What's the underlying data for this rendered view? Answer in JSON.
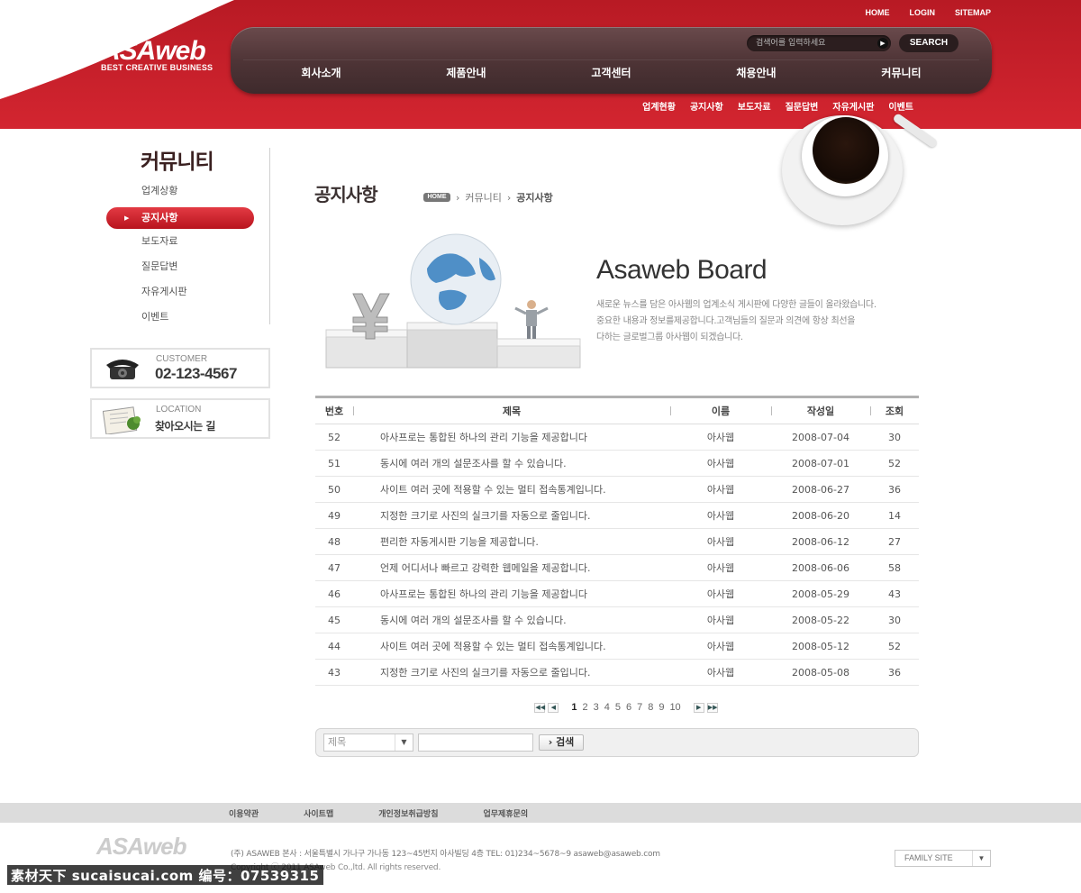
{
  "header": {
    "brand": {
      "name": "ASAweb",
      "tagline": "BEST CREATIVE BUSINESS"
    },
    "top_links": [
      "HOME",
      "LOGIN",
      "SITEMAP"
    ],
    "search": {
      "placeholder": "검색어를 입력하세요",
      "button_label": "SEARCH"
    },
    "main_nav": [
      "회사소개",
      "제품안내",
      "고객센터",
      "채용안내",
      "커뮤니티"
    ],
    "sub_nav": [
      "업계현황",
      "공지사항",
      "보도자료",
      "질문답변",
      "자유게시판",
      "이벤트"
    ]
  },
  "sidebar": {
    "title": "커뮤니티",
    "items": [
      {
        "label": "업계상황",
        "active": false
      },
      {
        "label": "공지사항",
        "active": true
      },
      {
        "label": "보도자료",
        "active": false
      },
      {
        "label": "질문답변",
        "active": false
      },
      {
        "label": "자유게시판",
        "active": false
      },
      {
        "label": "이벤트",
        "active": false
      }
    ],
    "customer": {
      "label": "CUSTOMER",
      "value": "02-123-4567"
    },
    "location": {
      "label": "LOCATION",
      "value": "찾아오시는 길"
    }
  },
  "content": {
    "page_title": "공지사항",
    "breadcrumb": {
      "home": "HOME",
      "section": "커뮤니티",
      "current": "공지사항"
    },
    "board_title": "Asaweb Board",
    "board_desc": [
      "새로운 뉴스를 담은 아사웹의 업계소식 게시판에 다양한 글들이 올라왔습니다.",
      "중요한 내용과 정보를제공합니다.고객님들의 질문과 의견에 항상 최선을",
      "다하는 글로벌그룹 아사웹이 되겠습니다."
    ],
    "table": {
      "columns": [
        "번호",
        "제목",
        "이름",
        "작성일",
        "조회"
      ],
      "rows": [
        [
          "52",
          "아사프로는 통합된 하나의 관리 기능을 제공합니다",
          "아사웹",
          "2008-07-04",
          "30"
        ],
        [
          "51",
          "동시에 여러 개의 설문조사를 할 수 있습니다.",
          "아사웹",
          "2008-07-01",
          "52"
        ],
        [
          "50",
          "사이트 여러 곳에 적용할 수 있는 멀티 접속통계입니다.",
          "아사웹",
          "2008-06-27",
          "36"
        ],
        [
          "49",
          "지정한 크기로 사진의 실크기를 자동으로 줄입니다.",
          "아사웹",
          "2008-06-20",
          "14"
        ],
        [
          "48",
          "편리한 자동게시판 기능을 제공합니다.",
          "아사웹",
          "2008-06-12",
          "27"
        ],
        [
          "47",
          "언제 어디서나 빠르고 강력한 웹메일을 제공합니다.",
          "아사웹",
          "2008-06-06",
          "58"
        ],
        [
          "46",
          "아사프로는 통합된 하나의 관리 기능을 제공합니다",
          "아사웹",
          "2008-05-29",
          "43"
        ],
        [
          "45",
          "동시에 여러 개의 설문조사를 할 수 있습니다.",
          "아사웹",
          "2008-05-22",
          "30"
        ],
        [
          "44",
          "사이트 여러 곳에 적용할 수 있는 멀티 접속통계입니다.",
          "아사웹",
          "2008-05-12",
          "52"
        ],
        [
          "43",
          "지정한 크기로 사진의 실크기를 자동으로 줄입니다.",
          "아사웹",
          "2008-05-08",
          "36"
        ]
      ]
    },
    "pagination": {
      "pages": [
        "1",
        "2",
        "3",
        "4",
        "5",
        "6",
        "7",
        "8",
        "9",
        "10"
      ],
      "current": "1"
    },
    "search": {
      "select_value": "제목",
      "button_label": "검색"
    }
  },
  "footer": {
    "links": [
      "이용약관",
      "사이트맵",
      "개인정보취급방침",
      "업무제휴문의"
    ],
    "logo": "ASAweb",
    "address": "(주) ASAWEB   본사 : 서울특별시 가나구 가나동 123~45번지  아사빌딩 4층 TEL: 01)234~5678~9  asaweb@asaweb.com",
    "copyright": "Copyright ⓒ 2011 ASAweb Co.,ltd. All rights reserved.",
    "family_site": "FAMILY SITE"
  },
  "watermark": "素材天下 sucaisucai.com   编号：07539315",
  "colors": {
    "brand_red": "#c8202b",
    "nav_dark": "#4e3436",
    "active_red": "#d32530"
  },
  "icons": [
    "phone-icon",
    "book-icon",
    "coffee-cup-illustration",
    "globe-podium-illustration"
  ]
}
